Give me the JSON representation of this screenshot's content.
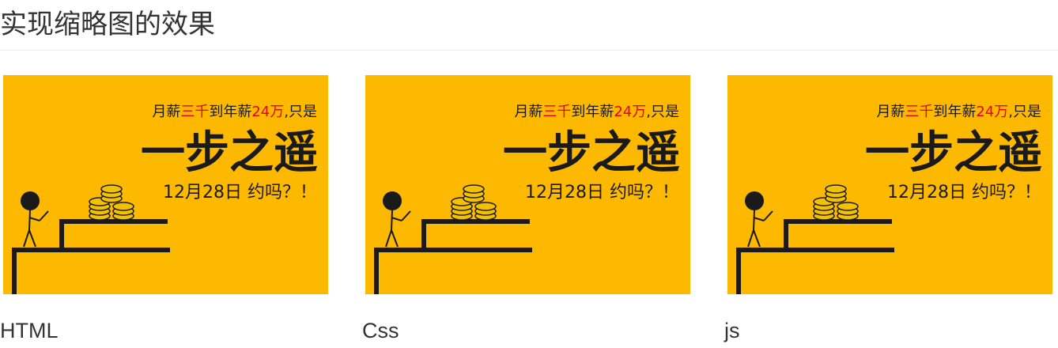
{
  "page": {
    "title": "实现缩略图的效果"
  },
  "thumbnails": [
    {
      "caption": "HTML",
      "poster": {
        "line1_a": "月薪",
        "line1_b": "三千",
        "line1_c": "到年薪",
        "line1_d": "24万",
        "line1_e": ",只是",
        "headline": "一步之遥",
        "date_line": "12月28日 约吗？！"
      }
    },
    {
      "caption": "Css",
      "poster": {
        "line1_a": "月薪",
        "line1_b": "三千",
        "line1_c": "到年薪",
        "line1_d": "24万",
        "line1_e": ",只是",
        "headline": "一步之遥",
        "date_line": "12月28日 约吗？！"
      }
    },
    {
      "caption": "js",
      "poster": {
        "line1_a": "月薪",
        "line1_b": "三千",
        "line1_c": "到年薪",
        "line1_d": "24万",
        "line1_e": ",只是",
        "headline": "一步之遥",
        "date_line": "12月28日 约吗？！"
      }
    }
  ],
  "colors": {
    "poster_background": "#FDB900",
    "highlight": "#E60012",
    "ink": "#1A1A1A",
    "coin": "#F2C200"
  },
  "icons": {
    "figure": "stick-figure-icon",
    "coins": "coin-stack-icon"
  }
}
